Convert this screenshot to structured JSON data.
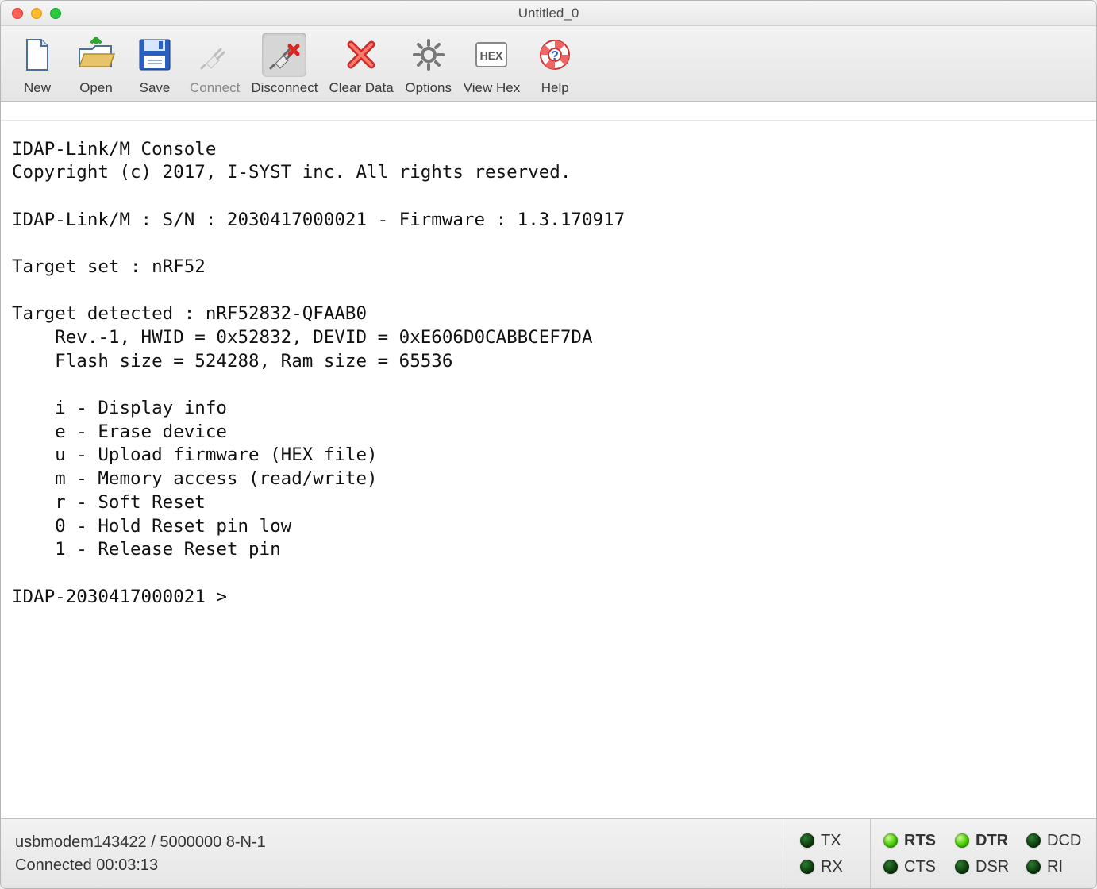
{
  "window": {
    "title": "Untitled_0"
  },
  "toolbar": {
    "new_label": "New",
    "open_label": "Open",
    "save_label": "Save",
    "connect_label": "Connect",
    "disconnect_label": "Disconnect",
    "cleardata_label": "Clear Data",
    "options_label": "Options",
    "viewhex_label": "View Hex",
    "help_label": "Help"
  },
  "console_lines": [
    "IDAP-Link/M Console",
    "Copyright (c) 2017, I-SYST inc. All rights reserved.",
    "",
    "IDAP-Link/M : S/N : 2030417000021 - Firmware : 1.3.170917",
    "",
    "Target set : nRF52",
    "",
    "Target detected : nRF52832-QFAAB0",
    "    Rev.-1, HWID = 0x52832, DEVID = 0xE606D0CABBCEF7DA",
    "    Flash size = 524288, Ram size = 65536",
    "",
    "    i - Display info",
    "    e - Erase device",
    "    u - Upload firmware (HEX file)",
    "    m - Memory access (read/write)",
    "    r - Soft Reset",
    "    0 - Hold Reset pin low",
    "    1 - Release Reset pin",
    "",
    "IDAP-2030417000021 >"
  ],
  "status": {
    "port": "usbmodem143422 / 5000000 8-N-1",
    "connected": "Connected 00:03:13",
    "leds": {
      "tx": {
        "label": "TX",
        "on": false,
        "bold": false
      },
      "rx": {
        "label": "RX",
        "on": false,
        "bold": false
      },
      "rts": {
        "label": "RTS",
        "on": true,
        "bold": true
      },
      "cts": {
        "label": "CTS",
        "on": false,
        "bold": false
      },
      "dtr": {
        "label": "DTR",
        "on": true,
        "bold": true
      },
      "dsr": {
        "label": "DSR",
        "on": false,
        "bold": false
      },
      "dcd": {
        "label": "DCD",
        "on": false,
        "bold": false
      },
      "ri": {
        "label": "RI",
        "on": false,
        "bold": false
      }
    }
  }
}
